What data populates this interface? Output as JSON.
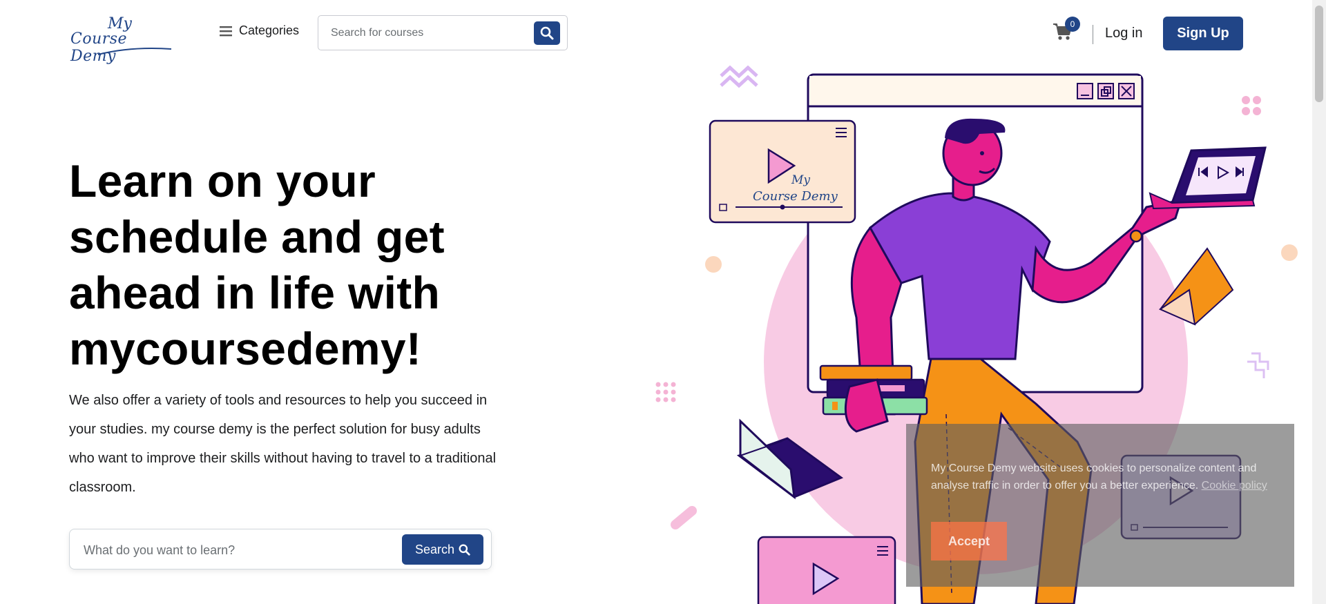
{
  "header": {
    "logo_line1": "My",
    "logo_line2": "Course Demy",
    "categories_label": "Categories",
    "search_placeholder": "Search for courses",
    "cart_count": "0",
    "login_label": "Log in",
    "signup_label": "Sign Up"
  },
  "hero": {
    "title": "Learn on your schedule and get ahead in life with mycoursedemy!",
    "description": "We also offer a variety of tools and resources to help you succeed in your studies. my course demy is the perfect solution for busy adults who want to improve their skills without having to travel to a traditional classroom.",
    "search_placeholder": "What do you want to learn?",
    "search_button": "Search"
  },
  "illustration": {
    "video_card_logo_line1": "My",
    "video_card_logo_line2": "Course Demy"
  },
  "cookie": {
    "message": "My Course Demy website uses cookies to personalize content and analyse traffic in order to offer you a better experience.",
    "link": "Cookie policy",
    "accept": "Accept"
  },
  "colors": {
    "brand": "#214587",
    "magenta": "#e61e8c",
    "purple": "#8a3fd6",
    "orange": "#f59216",
    "pink_bg": "#f8cbe4",
    "dark": "#1f0a5c"
  },
  "icons": [
    "hamburger-icon",
    "search-icon",
    "cart-icon",
    "play-icon",
    "minimize-icon",
    "restore-icon",
    "close-icon"
  ]
}
